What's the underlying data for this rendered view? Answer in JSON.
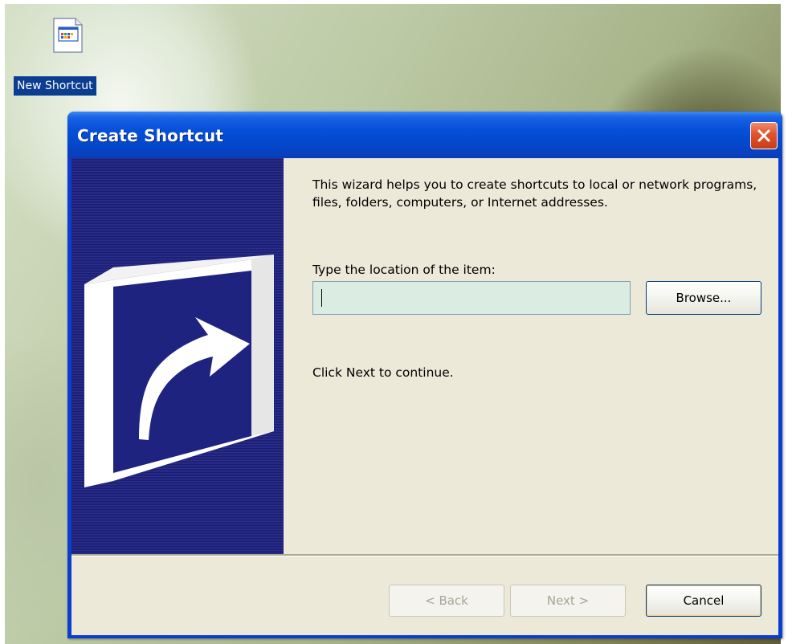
{
  "desktop": {
    "icon_label": "New Shortcut",
    "icon_name": "shortcut-file-icon"
  },
  "window": {
    "title": "Create Shortcut",
    "close_icon": "close-icon",
    "titlebar_color": "#0550d8",
    "close_color": "#e0532d"
  },
  "wizard": {
    "description": "This wizard helps you to create shortcuts to local or network programs, files, folders, computers, or Internet addresses.",
    "location_label": "Type the location of the item:",
    "location_value": "",
    "browse_label": "Browse...",
    "hint": "Click Next to continue.",
    "banner_icon": "shortcut-arrow-icon",
    "banner_color": "#1f2380"
  },
  "buttons": {
    "back": "< Back",
    "next": "Next >",
    "cancel": "Cancel"
  }
}
